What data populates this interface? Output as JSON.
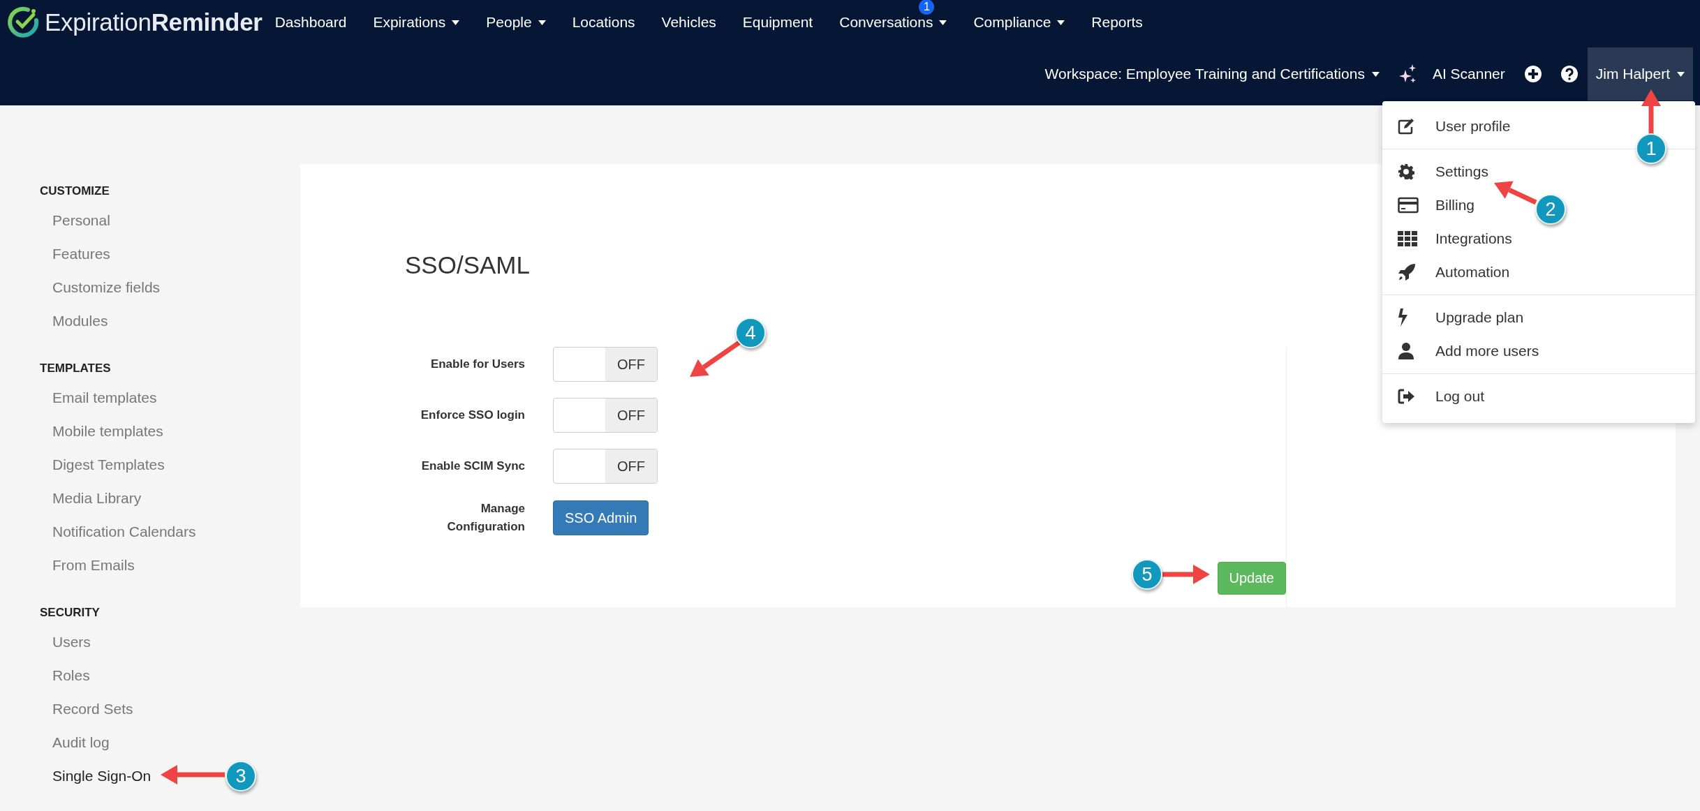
{
  "logo": {
    "text": "Expiration**Reminder**"
  },
  "nav": [
    {
      "label": "Dashboard",
      "dropdown": false
    },
    {
      "label": "Expirations",
      "dropdown": true
    },
    {
      "label": "People",
      "dropdown": true
    },
    {
      "label": "Locations",
      "dropdown": false
    },
    {
      "label": "Vehicles",
      "dropdown": false
    },
    {
      "label": "Equipment",
      "dropdown": false
    },
    {
      "label": "Conversations",
      "dropdown": true,
      "badge": "1"
    },
    {
      "label": "Compliance",
      "dropdown": true
    },
    {
      "label": "Reports",
      "dropdown": false
    }
  ],
  "toolbar": {
    "workspace": "Workspace: Employee Training and Certifications",
    "ai_scanner": "AI Scanner",
    "user": "Jim Halpert",
    "user_menu_expanded": true
  },
  "user_menu": [
    [
      {
        "label": "User profile",
        "kind": "edit"
      }
    ],
    [
      {
        "label": "Settings",
        "kind": "gear"
      },
      {
        "label": "Billing",
        "kind": "card"
      },
      {
        "label": "Integrations",
        "kind": "grid"
      },
      {
        "label": "Automation",
        "kind": "rocket"
      }
    ],
    [
      {
        "label": "Upgrade plan",
        "kind": "bolt"
      },
      {
        "label": "Add more users",
        "kind": "user"
      }
    ],
    [
      {
        "label": "Log out",
        "kind": "logout"
      }
    ]
  ],
  "sidebar": [
    {
      "heading": "CUSTOMIZE",
      "items": [
        {
          "label": "Personal",
          "selected": false
        },
        {
          "label": "Features",
          "selected": false
        },
        {
          "label": "Customize fields",
          "selected": false
        },
        {
          "label": "Modules",
          "selected": false
        }
      ]
    },
    {
      "heading": "TEMPLATES",
      "items": [
        {
          "label": "Email templates",
          "selected": false
        },
        {
          "label": "Mobile templates",
          "selected": false
        },
        {
          "label": "Digest Templates",
          "selected": false
        },
        {
          "label": "Media Library",
          "selected": false
        },
        {
          "label": "Notification Calendars",
          "selected": false
        },
        {
          "label": "From Emails",
          "selected": false
        }
      ]
    },
    {
      "heading": "SECURITY",
      "items": [
        {
          "label": "Users",
          "selected": false
        },
        {
          "label": "Roles",
          "selected": false
        },
        {
          "label": "Record Sets",
          "selected": false
        },
        {
          "label": "Audit log",
          "selected": false
        },
        {
          "label": "Single Sign-On",
          "selected": true
        }
      ]
    }
  ],
  "panel": {
    "title": "SSO/SAML",
    "rows": [
      {
        "kind": "toggle",
        "label": "Enable for Users",
        "on": false,
        "value_text": "OFF"
      },
      {
        "kind": "toggle",
        "label": "Enforce SSO login",
        "on": false,
        "value_text": "OFF"
      },
      {
        "kind": "toggle",
        "label": "Enable SCIM Sync",
        "on": false,
        "value_text": "OFF"
      },
      {
        "kind": "button",
        "label": "Manage Configuration",
        "button": "SSO Admin"
      }
    ],
    "submit": "Update"
  },
  "annotations": [
    {
      "label": "1"
    },
    {
      "label": "2"
    },
    {
      "label": "3"
    },
    {
      "label": "4"
    },
    {
      "label": "5"
    }
  ]
}
